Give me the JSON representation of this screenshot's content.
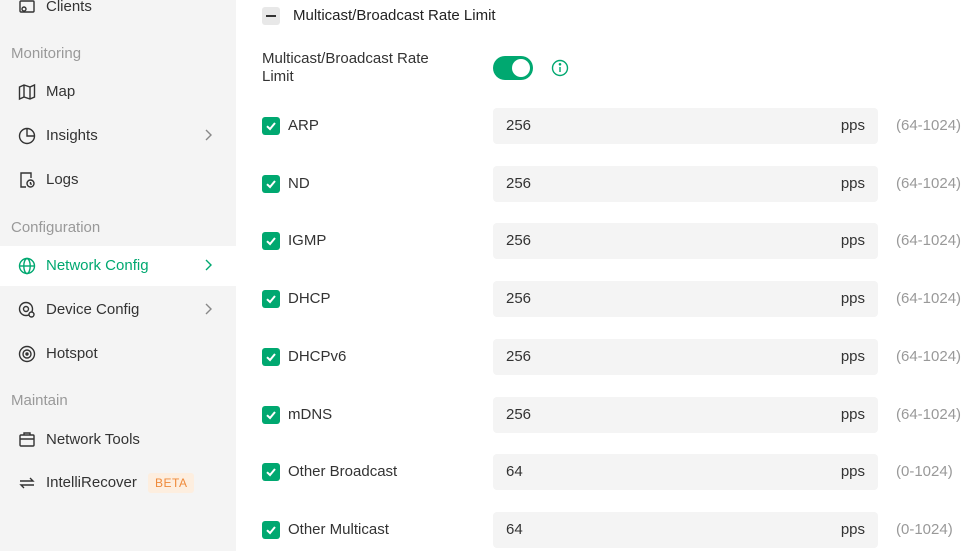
{
  "sidebar": {
    "clients": "Clients",
    "sections": {
      "monitoring": "Monitoring",
      "configuration": "Configuration",
      "maintain": "Maintain"
    },
    "items": {
      "map": "Map",
      "insights": "Insights",
      "logs": "Logs",
      "network_config": "Network Config",
      "device_config": "Device Config",
      "hotspot": "Hotspot",
      "network_tools": "Network Tools",
      "intellirecover": "IntelliRecover",
      "beta_badge": "BETA"
    }
  },
  "main": {
    "section_heading": "Multicast/Broadcast Rate Limit",
    "rate_limit_label": "Multicast/Broadcast Rate Limit",
    "rate_limit_enabled": true,
    "accent_color": "#00a870",
    "rows": [
      {
        "name": "ARP",
        "value": "256",
        "unit": "pps",
        "range": "(64-1024)",
        "checked": true
      },
      {
        "name": "ND",
        "value": "256",
        "unit": "pps",
        "range": "(64-1024)",
        "checked": true
      },
      {
        "name": "IGMP",
        "value": "256",
        "unit": "pps",
        "range": "(64-1024)",
        "checked": true
      },
      {
        "name": "DHCP",
        "value": "256",
        "unit": "pps",
        "range": "(64-1024)",
        "checked": true
      },
      {
        "name": "DHCPv6",
        "value": "256",
        "unit": "pps",
        "range": "(64-1024)",
        "checked": true
      },
      {
        "name": "mDNS",
        "value": "256",
        "unit": "pps",
        "range": "(64-1024)",
        "checked": true
      },
      {
        "name": "Other Broadcast",
        "value": "64",
        "unit": "pps",
        "range": "(0-1024)",
        "checked": true
      },
      {
        "name": "Other Multicast",
        "value": "64",
        "unit": "pps",
        "range": "(0-1024)",
        "checked": true
      }
    ]
  }
}
